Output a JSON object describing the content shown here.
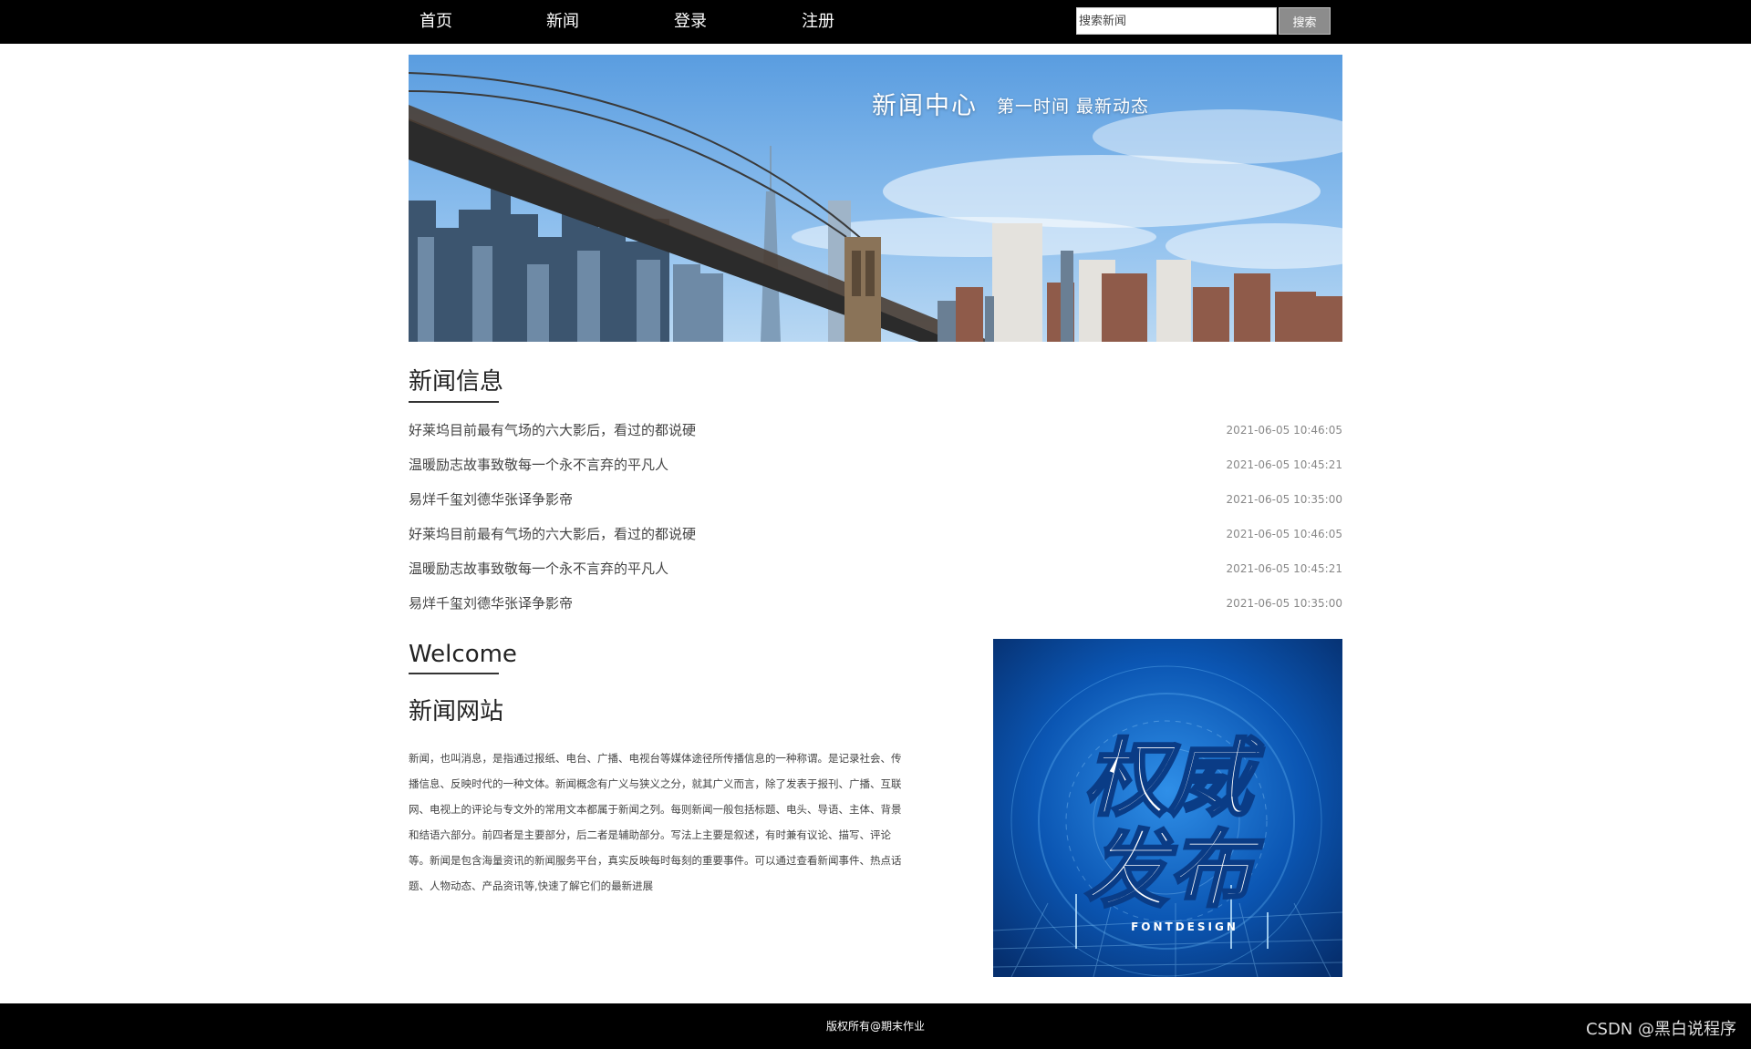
{
  "nav": {
    "items": [
      {
        "label": "首页"
      },
      {
        "label": "新闻"
      },
      {
        "label": "登录"
      },
      {
        "label": "注册"
      }
    ],
    "search": {
      "placeholder": "搜索新闻",
      "button_label": "搜索"
    }
  },
  "banner": {
    "title": "新闻中心",
    "subtitle": "第一时间  最新动态"
  },
  "news_section": {
    "heading": "新闻信息",
    "items": [
      {
        "title": "好莱坞目前最有气场的六大影后，看过的都说硬",
        "date": "2021-06-05 10:46:05"
      },
      {
        "title": "温暖励志故事致敬每一个永不言弃的平凡人",
        "date": "2021-06-05 10:45:21"
      },
      {
        "title": "易烊千玺刘德华张译争影帝",
        "date": "2021-06-05 10:35:00"
      },
      {
        "title": "好莱坞目前最有气场的六大影后，看过的都说硬",
        "date": "2021-06-05 10:46:05"
      },
      {
        "title": "温暖励志故事致敬每一个永不言弃的平凡人",
        "date": "2021-06-05 10:45:21"
      },
      {
        "title": "易烊千玺刘德华张译争影帝",
        "date": "2021-06-05 10:35:00"
      }
    ]
  },
  "welcome": {
    "heading": "Welcome",
    "subheading": "新闻网站",
    "body": "新闻，也叫消息，是指通过报纸、电台、广播、电视台等媒体途径所传播信息的一种称谓。是记录社会、传播信息、反映时代的一种文体。新闻概念有广义与狭义之分，就其广义而言，除了发表于报刊、广播、互联网、电视上的评论与专文外的常用文本都属于新闻之列。每则新闻一般包括标题、电头、导语、主体、背景和结语六部分。前四者是主要部分，后二者是辅助部分。写法上主要是叙述，有时兼有议论、描写、评论等。新闻是包含海量资讯的新闻服务平台，真实反映每时每刻的重要事件。可以通过查看新闻事件、热点话题、人物动态、产品资讯等,快速了解它们的最新进展"
  },
  "promo": {
    "line1": "权威",
    "line2": "发布",
    "caption": "FONTDESIGN"
  },
  "footer": {
    "copyright": "版权所有@期末作业",
    "watermark": "CSDN @黑白说程序"
  },
  "colors": {
    "bar": "#000000",
    "search_button": "#8c8c8c",
    "sky": "#4a8fd6",
    "promo_blue": "#0b4fa8"
  }
}
